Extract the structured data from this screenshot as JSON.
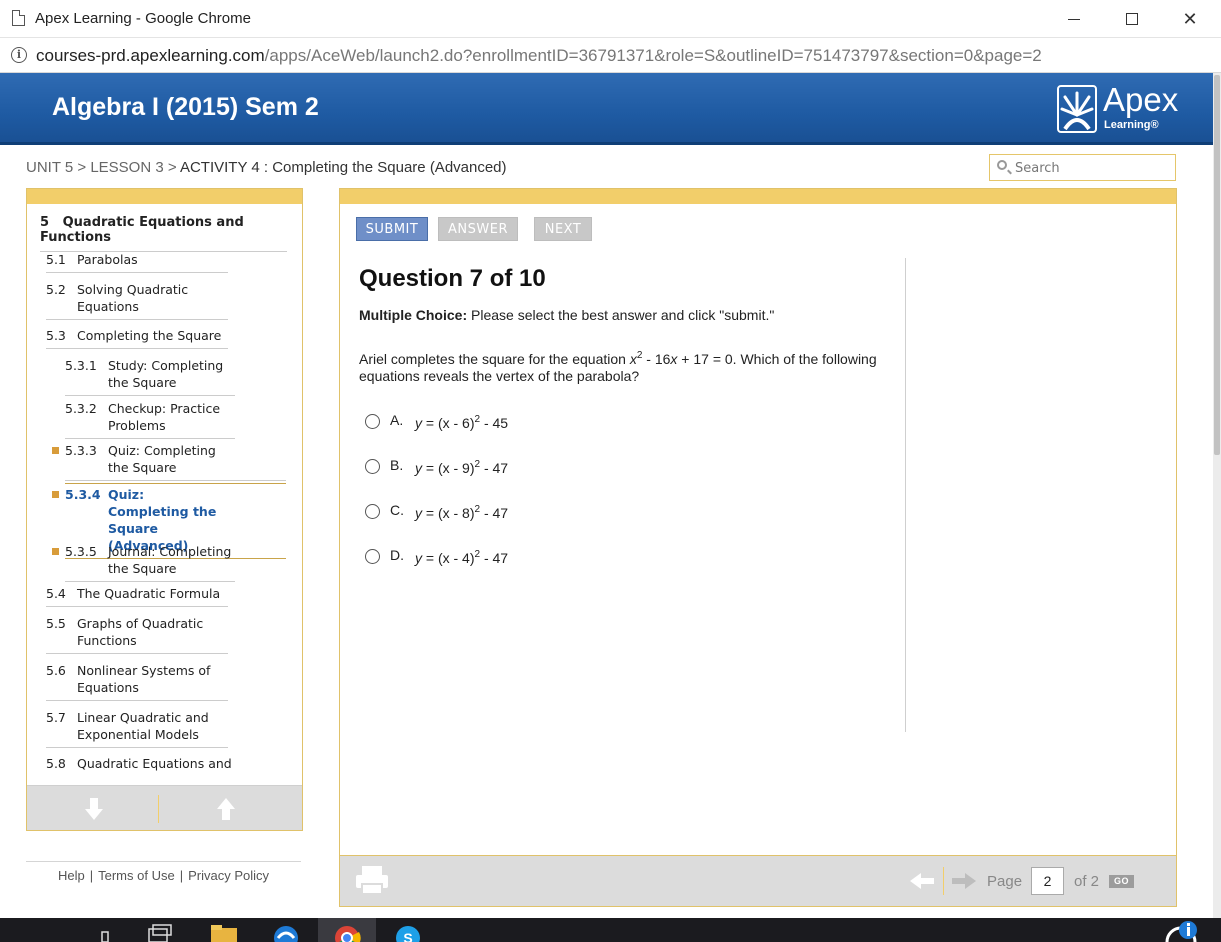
{
  "window": {
    "title": "Apex Learning - Google Chrome",
    "minimize_label": "–",
    "close_label": "✕"
  },
  "address": {
    "host": "courses-prd.apexlearning.com",
    "path": "/apps/AceWeb/launch2.do?enrollmentID=36791371&role=S&outlineID=751473797&section=0&page=2"
  },
  "header": {
    "course_title": "Algebra I (2015) Sem 2",
    "logo_word": "Apex",
    "logo_sub": "Learning®"
  },
  "breadcrumb": {
    "path": "UNIT 5 > LESSON 3 > ",
    "current": "ACTIVITY 4 : Completing the Square (Advanced)"
  },
  "search": {
    "placeholder": "Search"
  },
  "sidebar": {
    "unit_number": "5",
    "unit_title": "Quadratic Equations and Functions",
    "items": [
      {
        "num": "5.1",
        "label": "Parabolas"
      },
      {
        "num": "5.2",
        "label": "Solving Quadratic Equations"
      },
      {
        "num": "5.3",
        "label": "Completing the Square"
      },
      {
        "num": "5.3.1",
        "label": "Study: Completing the Square"
      },
      {
        "num": "5.3.2",
        "label": "Checkup: Practice Problems"
      },
      {
        "num": "5.3.3",
        "label": "Quiz: Completing the Square"
      },
      {
        "num": "5.3.4",
        "label": "Quiz: Completing the Square (Advanced)"
      },
      {
        "num": "5.3.5",
        "label": "Journal: Completing the Square"
      },
      {
        "num": "5.4",
        "label": "The Quadratic Formula"
      },
      {
        "num": "5.5",
        "label": "Graphs of Quadratic Functions"
      },
      {
        "num": "5.6",
        "label": "Nonlinear Systems of Equations"
      },
      {
        "num": "5.7",
        "label": "Linear Quadratic and Exponential Models"
      },
      {
        "num": "5.8",
        "label": "Quadratic Equations and"
      }
    ]
  },
  "footer_links": {
    "help": "Help",
    "terms": "Terms of Use",
    "privacy": "Privacy Policy",
    "sep": "|"
  },
  "toolbar": {
    "submit": "SUBMIT",
    "answer": "ANSWER",
    "next": "NEXT"
  },
  "question": {
    "title": "Question 7 of 10",
    "instructions_bold": "Multiple Choice:",
    "instructions": " Please select the best answer and click \"submit.\"",
    "text_before": "Ariel completes the square for the equation ",
    "var_x": "x",
    "sq": "2",
    "text_after_1": " - 16",
    "text_after_2": " + 17 = 0. Which of the following equations reveals the vertex of the parabola?",
    "choices": [
      {
        "letter": "A.",
        "y": "y",
        "inner": " = (x - 6)",
        "exp": "2",
        "tail": " - 45"
      },
      {
        "letter": "B.",
        "y": "y",
        "inner": " = (x - 9)",
        "exp": "2",
        "tail": " - 47"
      },
      {
        "letter": "C.",
        "y": "y",
        "inner": " = (x - 8)",
        "exp": "2",
        "tail": " - 47"
      },
      {
        "letter": "D.",
        "y": "y",
        "inner": " = (x - 4)",
        "exp": "2",
        "tail": " - 47"
      }
    ]
  },
  "pager": {
    "page_label": "Page",
    "current_page": "2",
    "of_label": "of 2",
    "go_label": "GO"
  }
}
